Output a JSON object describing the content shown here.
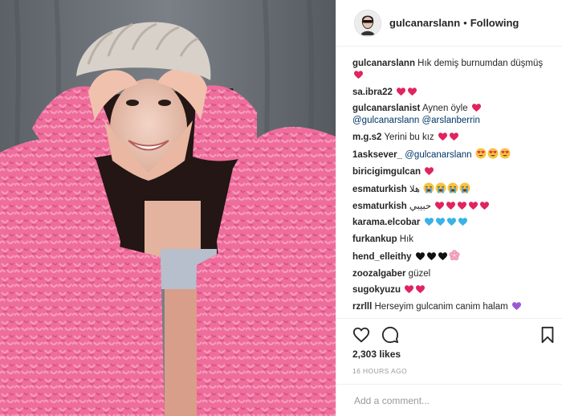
{
  "colors": {
    "accent": "#3897f0",
    "mention": "#003569",
    "heart_red": "#e0245e",
    "sweater_pink": "#ef6f9c"
  },
  "photo": {
    "icon": "post-photo"
  },
  "header": {
    "username": "gulcanarslann",
    "separator": "•",
    "follow_status": "Following"
  },
  "comments": [
    {
      "user": "gulcanarslann",
      "text": "Hık demiş burnumdan düşmüş",
      "emojis": [
        "red-heart"
      ]
    },
    {
      "user": "sa.ibra22",
      "text": "",
      "emojis": [
        "red-heart",
        "red-heart"
      ]
    },
    {
      "user": "gulcanarslanist",
      "text": "Aynen öyle",
      "emojis": [
        "red-heart"
      ],
      "after": [
        "@gulcanarslann",
        "@arslanberrin"
      ]
    },
    {
      "user": "m.g.s2",
      "text": "Yerini bu kız",
      "emojis": [
        "red-heart",
        "red-heart"
      ]
    },
    {
      "user": "1asksever_",
      "text": "@gulcanarslann",
      "emojis": [
        "heart-eyes",
        "heart-eyes",
        "heart-eyes"
      ]
    },
    {
      "user": "biricigimgulcan",
      "text": "",
      "emojis": [
        "red-heart"
      ]
    },
    {
      "user": "esmaturkish",
      "text": "هلا",
      "emojis": [
        "crying-face",
        "crying-face",
        "crying-face",
        "crying-face"
      ]
    },
    {
      "user": "esmaturkish",
      "text": "حبيبي",
      "emojis": [
        "red-heart",
        "red-heart",
        "red-heart",
        "red-heart",
        "red-heart"
      ]
    },
    {
      "user": "karama.elcobar",
      "text": "",
      "emojis": [
        "blue-heart",
        "blue-heart",
        "blue-heart",
        "blue-heart"
      ]
    },
    {
      "user": "furkankup",
      "text": "Hık",
      "emojis": []
    },
    {
      "user": "hend_elleithy",
      "text": "",
      "emojis": [
        "black-heart",
        "black-heart",
        "black-heart",
        "cherry-blossom"
      ]
    },
    {
      "user": "zoozalgaber",
      "text": "güzel",
      "emojis": []
    },
    {
      "user": "sugokyuzu",
      "text": "",
      "emojis": [
        "red-heart",
        "red-heart"
      ]
    },
    {
      "user": "rzrlll",
      "text": "Herseyim gulcanim canim halam",
      "emojis": [
        "purple-heart"
      ]
    }
  ],
  "actions": {
    "like": "heart-outline-icon",
    "comment": "comment-bubble-icon",
    "save": "bookmark-icon"
  },
  "likes": "2,303 likes",
  "timestamp": "16 HOURS AGO",
  "add_comment": {
    "placeholder": "Add a comment...",
    "value": ""
  }
}
